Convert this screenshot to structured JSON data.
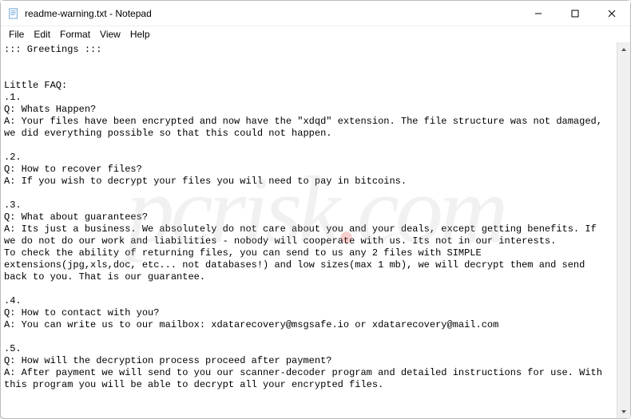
{
  "titlebar": {
    "title": "readme-warning.txt - Notepad"
  },
  "menu": {
    "file": "File",
    "edit": "Edit",
    "format": "Format",
    "view": "View",
    "help": "Help"
  },
  "content": {
    "text": "::: Greetings :::\n\n\nLittle FAQ:\n.1.\nQ: Whats Happen?\nA: Your files have been encrypted and now have the \"xdqd\" extension. The file structure was not damaged, we did everything possible so that this could not happen.\n\n.2.\nQ: How to recover files?\nA: If you wish to decrypt your files you will need to pay in bitcoins.\n\n.3.\nQ: What about guarantees?\nA: Its just a business. We absolutely do not care about you and your deals, except getting benefits. If we do not do our work and liabilities - nobody will cooperate with us. Its not in our interests.\nTo check the ability of returning files, you can send to us any 2 files with SIMPLE extensions(jpg,xls,doc, etc... not databases!) and low sizes(max 1 mb), we will decrypt them and send back to you. That is our guarantee.\n\n.4.\nQ: How to contact with you?\nA: You can write us to our mailbox: xdatarecovery@msgsafe.io or xdatarecovery@mail.com\n\n.5.\nQ: How will the decryption process proceed after payment?\nA: After payment we will send to you our scanner-decoder program and detailed instructions for use. With this program you will be able to decrypt all your encrypted files."
  },
  "watermark": {
    "prefix": "pc",
    "suffix": "risk",
    "dot": ".",
    "tld": "com"
  }
}
